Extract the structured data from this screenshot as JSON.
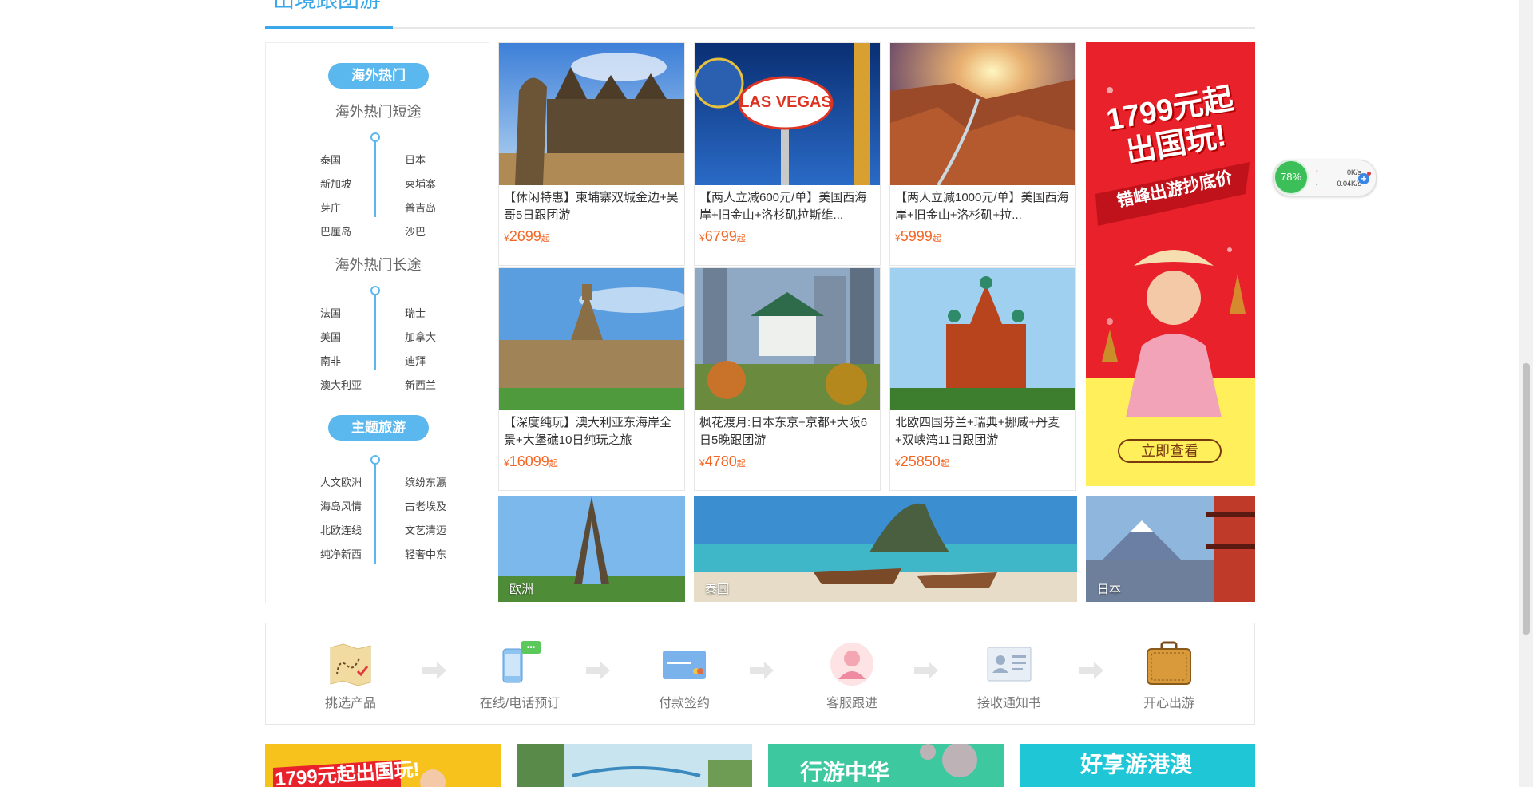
{
  "section_title": "出境跟团游",
  "left_panel": {
    "group1_pill": "海外热门",
    "short_title": "海外热门短途",
    "short_links": [
      "泰国",
      "日本",
      "新加坡",
      "柬埔寨",
      "芽庄",
      "普吉岛",
      "巴厘岛",
      "沙巴"
    ],
    "long_title": "海外热门长途",
    "long_links": [
      "法国",
      "瑞士",
      "美国",
      "加拿大",
      "南非",
      "迪拜",
      "澳大利亚",
      "新西兰"
    ],
    "group2_pill": "主题旅游",
    "theme_links": [
      "人文欧洲",
      "缤纷东瀛",
      "海岛风情",
      "古老埃及",
      "北欧连线",
      "文艺清迈",
      "纯净新西",
      "轻奢中东"
    ]
  },
  "cards": [
    {
      "name": "【休闲特惠】柬埔寨双城金边+吴哥5日跟团游",
      "price": "2699"
    },
    {
      "name": "【两人立减600元/单】美国西海岸+旧金山+洛杉矶拉斯维...",
      "price": "6799"
    },
    {
      "name": "【两人立减1000元/单】美国西海岸+旧金山+洛杉矶+拉...",
      "price": "5999"
    },
    {
      "name": "【深度纯玩】澳大利亚东海岸全景+大堡礁10日纯玩之旅",
      "price": "16099"
    },
    {
      "name": "枫花渡月:日本东京+京都+大阪6日5晚跟团游",
      "price": "4780"
    },
    {
      "name": "北欧四国芬兰+瑞典+挪威+丹麦+双峡湾11日跟团游",
      "price": "25850"
    }
  ],
  "price_currency": "¥",
  "price_suffix": "起",
  "banner": {
    "headline1": "1799元起",
    "headline2": "出国玩!",
    "tagline": "错峰出游抄底价",
    "button": "立即查看"
  },
  "destinations": [
    "欧洲",
    "泰国",
    "日本"
  ],
  "steps": [
    "挑选产品",
    "在线/电话预订",
    "付款签约",
    "客服跟进",
    "接收通知书",
    "开心出游"
  ],
  "promos": [
    {
      "text": "1799元起出国玩!"
    },
    {
      "text": ""
    },
    {
      "text": "行游中华"
    },
    {
      "text": "好享游港澳"
    }
  ],
  "speed_widget": {
    "percent": "78%",
    "up": "0K/s",
    "down": "0.04K/s"
  },
  "colors": {
    "accent": "#3aa7e8",
    "price": "#f26522",
    "banner_red": "#e8212b",
    "banner_yellow": "#ffef5a"
  }
}
